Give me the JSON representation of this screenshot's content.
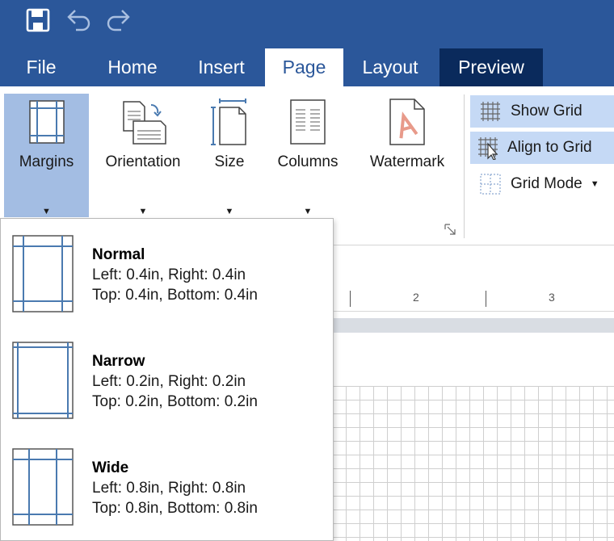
{
  "quick_access": {
    "save": "save-icon",
    "undo": "undo-icon",
    "redo": "redo-icon"
  },
  "tabs": [
    {
      "label": "File"
    },
    {
      "label": "Home"
    },
    {
      "label": "Insert"
    },
    {
      "label": "Page",
      "active": true
    },
    {
      "label": "Layout"
    },
    {
      "label": "Preview"
    }
  ],
  "ribbon": {
    "margins": "Margins",
    "orientation": "Orientation",
    "size": "Size",
    "columns": "Columns",
    "watermark": "Watermark",
    "show_grid": "Show Grid",
    "align_to_grid": "Align to Grid",
    "grid_mode": "Grid Mode"
  },
  "ruler": {
    "labels": [
      "2",
      "3"
    ]
  },
  "margin_options": [
    {
      "name": "Normal",
      "line1": "Left: 0.4in, Right: 0.4in",
      "line2": "Top: 0.4in, Bottom: 0.4in"
    },
    {
      "name": "Narrow",
      "line1": "Left: 0.2in, Right: 0.2in",
      "line2": "Top: 0.2in, Bottom: 0.2in"
    },
    {
      "name": "Wide",
      "line1": "Left: 0.8in, Right: 0.8in",
      "line2": "Top: 0.8in, Bottom: 0.8in"
    }
  ],
  "colors": {
    "titlebar": "#2b579a",
    "preview_tab": "#0a2a5c",
    "selected_button": "#a3bde3",
    "highlight_row": "#c5d9f5",
    "margin_line": "#4a7ab0",
    "watermark_accent": "#e89a8a"
  }
}
